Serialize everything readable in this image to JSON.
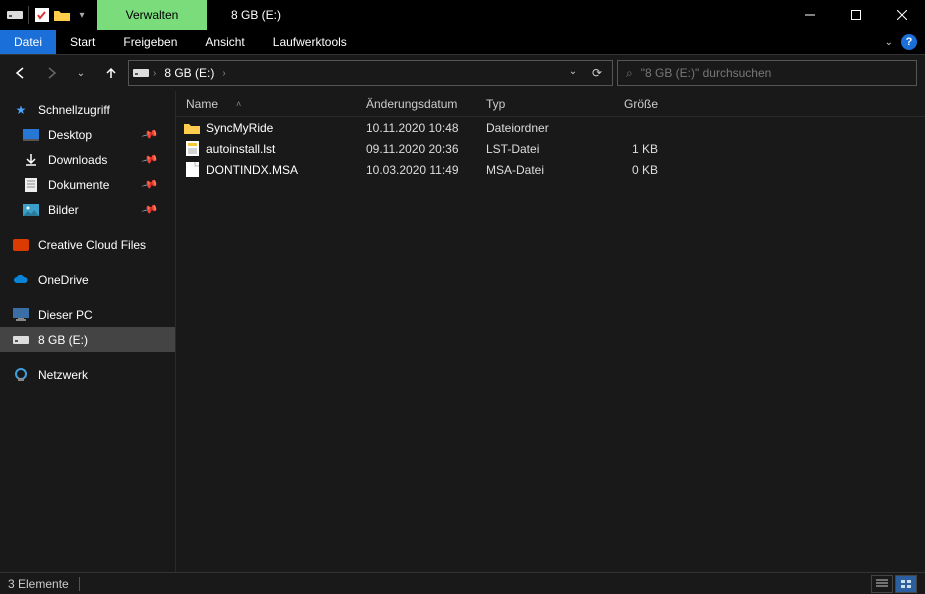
{
  "window": {
    "title": "8 GB (E:)",
    "manage_label": "Verwalten"
  },
  "ribbon": {
    "file": "Datei",
    "tabs": [
      "Start",
      "Freigeben",
      "Ansicht",
      "Laufwerktools"
    ]
  },
  "breadcrumb": {
    "segment": "8 GB (E:)"
  },
  "search": {
    "placeholder": "\"8 GB (E:)\" durchsuchen"
  },
  "sidebar": {
    "quick": "Schnellzugriff",
    "desktop": "Desktop",
    "downloads": "Downloads",
    "documents": "Dokumente",
    "pictures": "Bilder",
    "ccf": "Creative Cloud Files",
    "onedrive": "OneDrive",
    "thispc": "Dieser PC",
    "drive": "8 GB (E:)",
    "network": "Netzwerk"
  },
  "columns": {
    "name": "Name",
    "date": "Änderungsdatum",
    "type": "Typ",
    "size": "Größe"
  },
  "rows": [
    {
      "name": "SyncMyRide",
      "date": "10.11.2020 10:48",
      "type": "Dateiordner",
      "size": "",
      "icon": "folder"
    },
    {
      "name": "autoinstall.lst",
      "date": "09.11.2020 20:36",
      "type": "LST-Datei",
      "size": "1 KB",
      "icon": "lst"
    },
    {
      "name": "DONTINDX.MSA",
      "date": "10.03.2020 11:49",
      "type": "MSA-Datei",
      "size": "0 KB",
      "icon": "file"
    }
  ],
  "status": {
    "count": "3 Elemente"
  }
}
